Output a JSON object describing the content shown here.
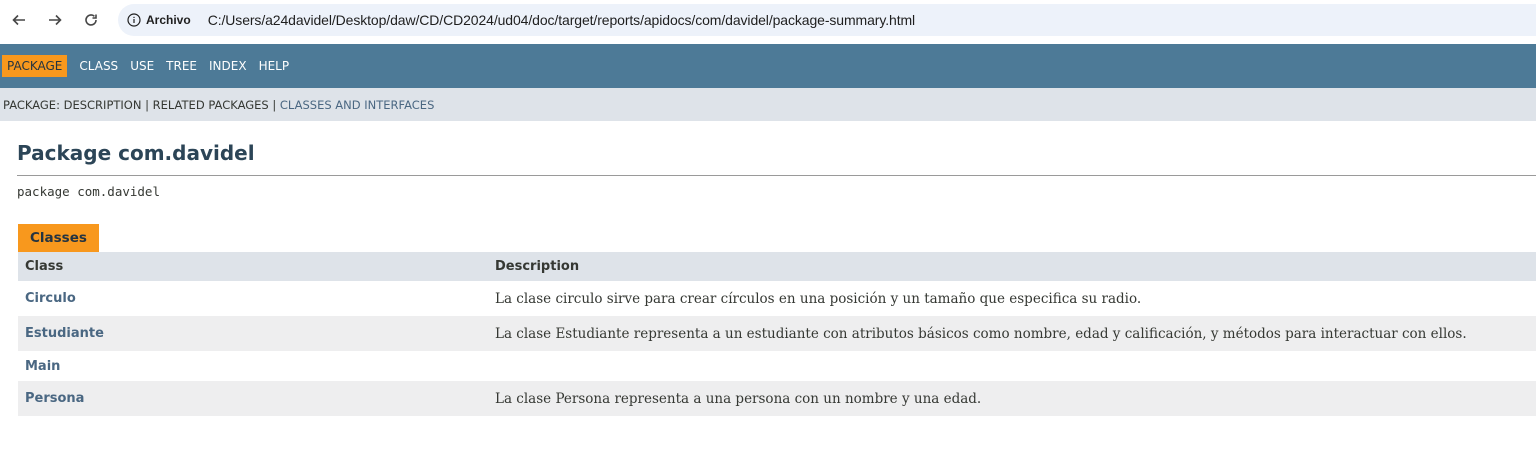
{
  "browser": {
    "scheme_label": "Archivo",
    "url": "C:/Users/a24davidel/Desktop/daw/CD/CD2024/ud04/doc/target/reports/apidocs/com/davidel/package-summary.html"
  },
  "top_nav": {
    "items": [
      {
        "label": "PACKAGE"
      },
      {
        "label": "CLASS"
      },
      {
        "label": "USE"
      },
      {
        "label": "TREE"
      },
      {
        "label": "INDEX"
      },
      {
        "label": "HELP"
      }
    ]
  },
  "sub_nav": {
    "prefix": "PACKAGE: DESCRIPTION | RELATED PACKAGES | ",
    "link": "CLASSES AND INTERFACES"
  },
  "page": {
    "title": "Package com.davidel",
    "declaration": "package com.davidel"
  },
  "classes_table": {
    "caption": "Classes",
    "headers": {
      "class": "Class",
      "description": "Description"
    },
    "rows": [
      {
        "class": "Circulo",
        "description": "La clase circulo sirve para crear círculos en una posición y un tamaño que especifica su radio."
      },
      {
        "class": "Estudiante",
        "description": "La clase Estudiante representa a un estudiante con atributos básicos como nombre, edad y calificación, y métodos para interactuar con ellos."
      },
      {
        "class": "Main",
        "description": ""
      },
      {
        "class": "Persona",
        "description": "La clase Persona representa a una persona con un nombre y una edad."
      }
    ]
  },
  "colors": {
    "nav_bg": "#4d7a97",
    "subnav_bg": "#dee3e9",
    "accent": "#f8981d",
    "link": "#4a6782",
    "title": "#2c4557"
  }
}
